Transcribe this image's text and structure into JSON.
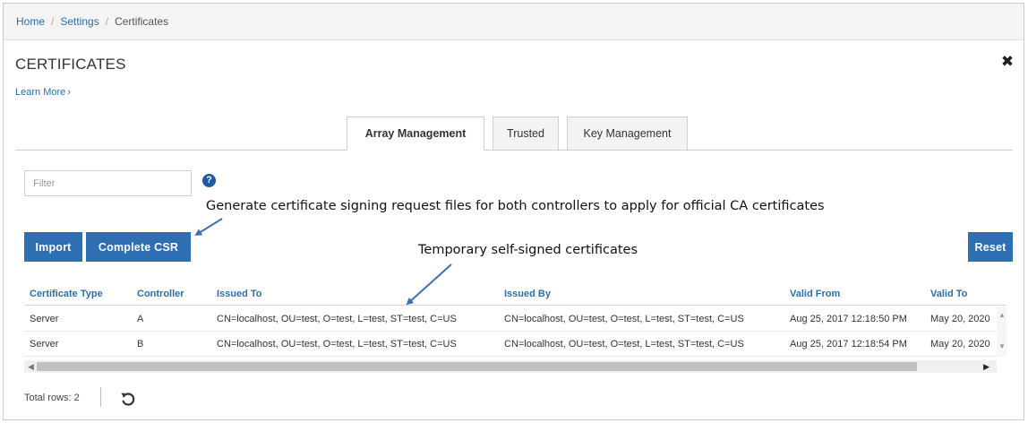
{
  "breadcrumb": {
    "home": "Home",
    "settings": "Settings",
    "current": "Certificates",
    "separator": "/"
  },
  "page": {
    "title": "CERTIFICATES",
    "learn_more": "Learn More",
    "learn_more_chevron": "›",
    "close_glyph": "✖"
  },
  "tabs": [
    {
      "label": "Array Management",
      "active": true
    },
    {
      "label": "Trusted",
      "active": false
    },
    {
      "label": "Key Management",
      "active": false
    }
  ],
  "filter": {
    "placeholder": "Filter",
    "value": "",
    "help_glyph": "?"
  },
  "annotations": {
    "csr": "Generate certificate signing request files for both controllers to apply for official CA certificates",
    "temporary": "Temporary self-signed certificates"
  },
  "buttons": {
    "import": "Import",
    "complete_csr": "Complete CSR",
    "reset": "Reset"
  },
  "table": {
    "columns": [
      "Certificate Type",
      "Controller",
      "Issued To",
      "Issued By",
      "Valid From",
      "Valid To"
    ],
    "rows": [
      [
        "Server",
        "A",
        "CN=localhost, OU=test, O=test, L=test, ST=test, C=US",
        "CN=localhost, OU=test, O=test, L=test, ST=test, C=US",
        "Aug 25, 2017 12:18:50 PM",
        "May 20, 2020"
      ],
      [
        "Server",
        "B",
        "CN=localhost, OU=test, O=test, L=test, ST=test, C=US",
        "CN=localhost, OU=test, O=test, L=test, ST=test, C=US",
        "Aug 25, 2017 12:18:54 PM",
        "May 20, 2020"
      ]
    ]
  },
  "footer": {
    "total_rows": "Total rows: 2"
  },
  "colors": {
    "link": "#2a6fb0",
    "button": "#2e6fb4",
    "help": "#1d5aa0",
    "arrow": "#3f6fb5"
  },
  "icons": {
    "close": "close-icon",
    "help": "help-icon",
    "refresh": "refresh-icon"
  }
}
